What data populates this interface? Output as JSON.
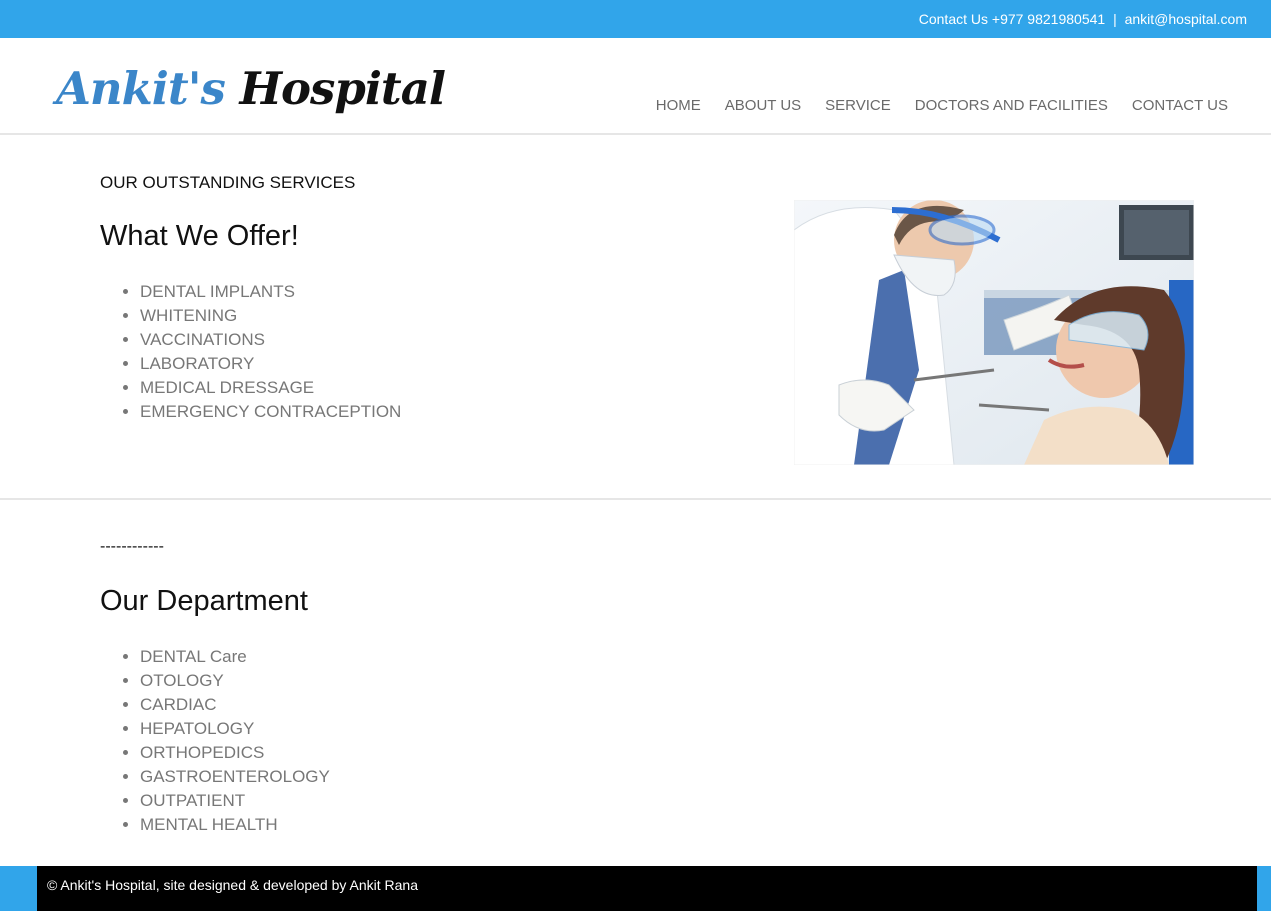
{
  "topbar": {
    "contact_text": "Contact Us +977 9821980541",
    "separator": "|",
    "email": "ankit@hospital.com"
  },
  "header": {
    "logo_first": "Ankit's",
    "logo_second": "Hospital",
    "nav": [
      "HOME",
      "ABOUT US",
      "SERVICE",
      "DOCTORS AND FACILITIES",
      "CONTACT US"
    ]
  },
  "services": {
    "kicker": "OUR OUTSTANDING SERVICES",
    "title": "What We Offer!",
    "items": [
      "DENTAL IMPLANTS",
      "WHITENING",
      "VACCINATIONS",
      "LABORATORY",
      "MEDICAL DRESSAGE",
      "EMERGENCY CONTRACEPTION"
    ]
  },
  "department": {
    "dashes": "------------",
    "title": "Our Department",
    "items": [
      "DENTAL Care",
      "OTOLOGY",
      "CARDIAC",
      "HEPATOLOGY",
      "ORTHOPEDICS",
      "GASTROENTEROLOGY",
      "OUTPATIENT",
      "MENTAL HEALTH"
    ]
  },
  "footer": {
    "text": "© Ankit's Hospital, site designed & developed by Ankit Rana"
  },
  "colors": {
    "topbar": "#31a5ea",
    "logo_blue": "#3b86c9",
    "nav_text": "#6a6a6a",
    "list_text": "#777777",
    "footer_bg": "#000000"
  }
}
